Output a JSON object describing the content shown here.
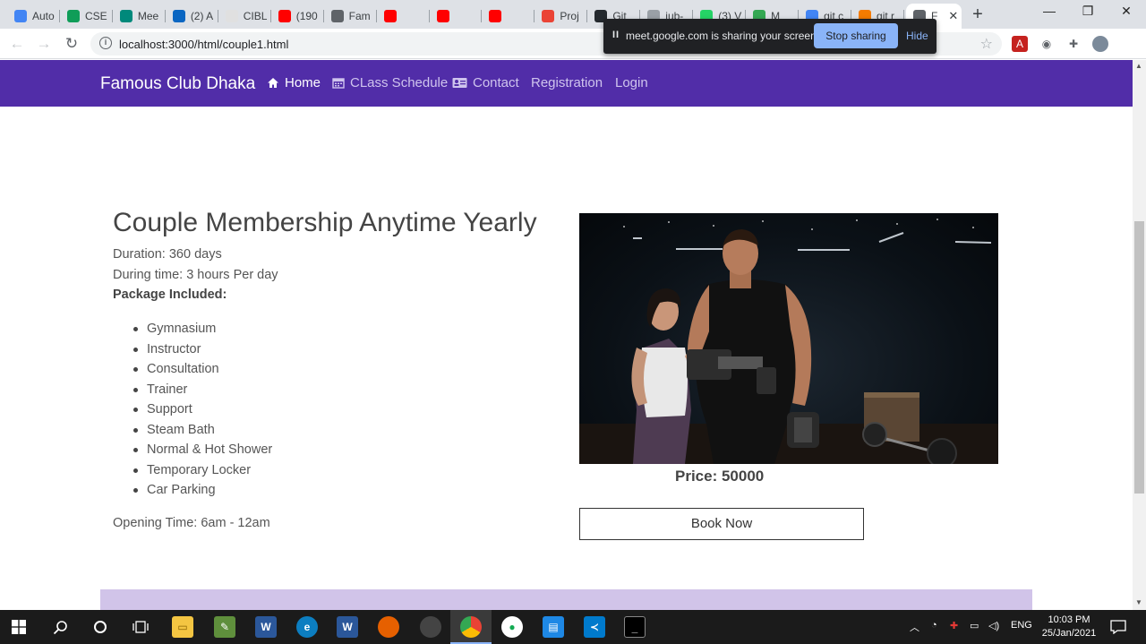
{
  "browser": {
    "tabs": [
      {
        "label": "Auto",
        "color": "#4285f4"
      },
      {
        "label": "CSE",
        "color": "#0f9d58"
      },
      {
        "label": "Mee",
        "color": "#00897b"
      },
      {
        "label": "(2) A",
        "color": "#0a66c2"
      },
      {
        "label": "CIBL",
        "color": "#e0e0e0"
      },
      {
        "label": "(190",
        "color": "#ff0000"
      },
      {
        "label": "Fam",
        "color": "#5f6368"
      },
      {
        "label": "",
        "color": "#ff0000"
      },
      {
        "label": "",
        "color": "#ff0000"
      },
      {
        "label": "",
        "color": "#ff0000"
      },
      {
        "label": "Proj",
        "color": "#ea4335"
      },
      {
        "label": "Git",
        "color": "#24292e"
      },
      {
        "label": "iub-",
        "color": "#9aa0a6"
      },
      {
        "label": "(3) V",
        "color": "#25d366"
      },
      {
        "label": "M",
        "color": "#34a853"
      },
      {
        "label": "git c",
        "color": "#4285f4"
      },
      {
        "label": "git r",
        "color": "#f57c00"
      },
      {
        "label": "F",
        "color": "#5f6368"
      }
    ],
    "new_tab": "+",
    "window_controls": {
      "minimize": "—",
      "restore": "❐",
      "close": "✕"
    },
    "url": "localhost:3000/html/couple1.html",
    "nav": {
      "back": "←",
      "forward": "→",
      "reload": "↻"
    },
    "screen_share": {
      "message": "meet.google.com is sharing your screen.",
      "stop": "Stop sharing",
      "hide": "Hide"
    }
  },
  "site": {
    "brand": "Famous Club Dhaka",
    "nav": [
      {
        "label": "Home",
        "icon": "home-icon",
        "active": true
      },
      {
        "label": "CLass Schedule",
        "icon": "calendar-icon",
        "active": false
      },
      {
        "label": "Contact",
        "icon": "contact-card-icon",
        "active": false
      },
      {
        "label": "Registration",
        "icon": "",
        "active": false
      },
      {
        "label": "Login",
        "icon": "",
        "active": false
      }
    ],
    "colors": {
      "navbar": "#512da8",
      "footer_strip": "#d1c4e9"
    }
  },
  "membership": {
    "title": "Couple Membership Anytime Yearly",
    "duration": "Duration: 360 days",
    "during_time": "During time: 3 hours Per day",
    "package_heading": "Package Included:",
    "package_items": [
      "Gymnasium",
      "Instructor",
      "Consultation",
      "Trainer",
      "Support",
      "Steam Bath",
      "Normal & Hot Shower",
      "Temporary Locker",
      "Car Parking"
    ],
    "opening_time": "Opening Time: 6am - 12am",
    "price": "Price: 50000",
    "book_button": "Book Now"
  },
  "taskbar": {
    "language": "ENG",
    "time": "10:03 PM",
    "date": "25/Jan/2021"
  }
}
